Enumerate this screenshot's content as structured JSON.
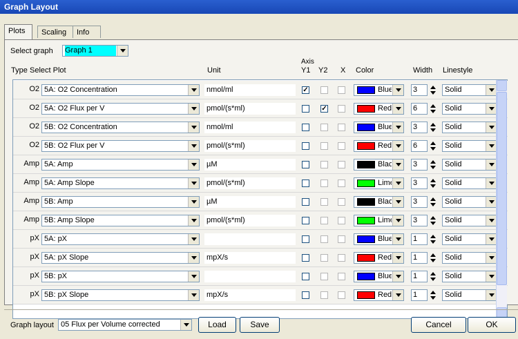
{
  "window": {
    "title": "Graph Layout"
  },
  "tabs": [
    {
      "label": "Plots",
      "active": true
    },
    {
      "label": "Scaling"
    },
    {
      "label": "Info"
    }
  ],
  "select_graph": {
    "label": "Select graph",
    "value": "Graph 1",
    "highlight": "#00ffff"
  },
  "headers": {
    "type": "Type",
    "select_plot": "Select Plot",
    "unit": "Unit",
    "axis": "Axis",
    "y1": "Y1",
    "y2": "Y2",
    "x": "X",
    "color": "Color",
    "width": "Width",
    "linestyle": "Linestyle"
  },
  "rows": [
    {
      "type": "O2",
      "plot": "5A: O2 Concentration",
      "unit": "nmol/ml",
      "y1": true,
      "y2": false,
      "x": false,
      "color": "Blue",
      "hex": "#0000ff",
      "width": "3",
      "linestyle": "Solid"
    },
    {
      "type": "O2",
      "plot": "5A: O2 Flux per V",
      "unit": "pmol/(s*ml)",
      "y1": false,
      "y2": true,
      "x": false,
      "color": "Red",
      "hex": "#ff0000",
      "width": "6",
      "linestyle": "Solid"
    },
    {
      "type": "O2",
      "plot": "5B: O2 Concentration",
      "unit": "nmol/ml",
      "y1": false,
      "y2": false,
      "x": false,
      "color": "Blue",
      "hex": "#0000ff",
      "width": "3",
      "linestyle": "Solid"
    },
    {
      "type": "O2",
      "plot": "5B: O2 Flux per V",
      "unit": "pmol/(s*ml)",
      "y1": false,
      "y2": false,
      "x": false,
      "color": "Red",
      "hex": "#ff0000",
      "width": "6",
      "linestyle": "Solid"
    },
    {
      "type": "Amp",
      "plot": "5A: Amp",
      "unit": "µM",
      "y1": false,
      "y2": false,
      "x": false,
      "color": "Black",
      "hex": "#000000",
      "width": "3",
      "linestyle": "Solid"
    },
    {
      "type": "Amp",
      "plot": "5A: Amp Slope",
      "unit": "pmol/(s*ml)",
      "y1": false,
      "y2": false,
      "x": false,
      "color": "Lime",
      "hex": "#00ff00",
      "width": "3",
      "linestyle": "Solid"
    },
    {
      "type": "Amp",
      "plot": "5B: Amp",
      "unit": "µM",
      "y1": false,
      "y2": false,
      "x": false,
      "color": "Black",
      "hex": "#000000",
      "width": "3",
      "linestyle": "Solid"
    },
    {
      "type": "Amp",
      "plot": "5B: Amp Slope",
      "unit": "pmol/(s*ml)",
      "y1": false,
      "y2": false,
      "x": false,
      "color": "Lime",
      "hex": "#00ff00",
      "width": "3",
      "linestyle": "Solid"
    },
    {
      "type": "pX",
      "plot": "5A: pX",
      "unit": "",
      "y1": false,
      "y2": false,
      "x": false,
      "color": "Blue",
      "hex": "#0000ff",
      "width": "1",
      "linestyle": "Solid"
    },
    {
      "type": "pX",
      "plot": "5A: pX Slope",
      "unit": "mpX/s",
      "y1": false,
      "y2": false,
      "x": false,
      "color": "Red",
      "hex": "#ff0000",
      "width": "1",
      "linestyle": "Solid"
    },
    {
      "type": "pX",
      "plot": "5B: pX",
      "unit": "",
      "y1": false,
      "y2": false,
      "x": false,
      "color": "Blue",
      "hex": "#0000ff",
      "width": "1",
      "linestyle": "Solid"
    },
    {
      "type": "pX",
      "plot": "5B: pX Slope",
      "unit": "mpX/s",
      "y1": false,
      "y2": false,
      "x": false,
      "color": "Red",
      "hex": "#ff0000",
      "width": "1",
      "linestyle": "Solid"
    }
  ],
  "footer": {
    "graph_layout_label": "Graph layout",
    "graph_layout_value": "05 Flux per Volume corrected",
    "load": "Load",
    "save": "Save",
    "cancel": "Cancel",
    "ok": "OK"
  }
}
